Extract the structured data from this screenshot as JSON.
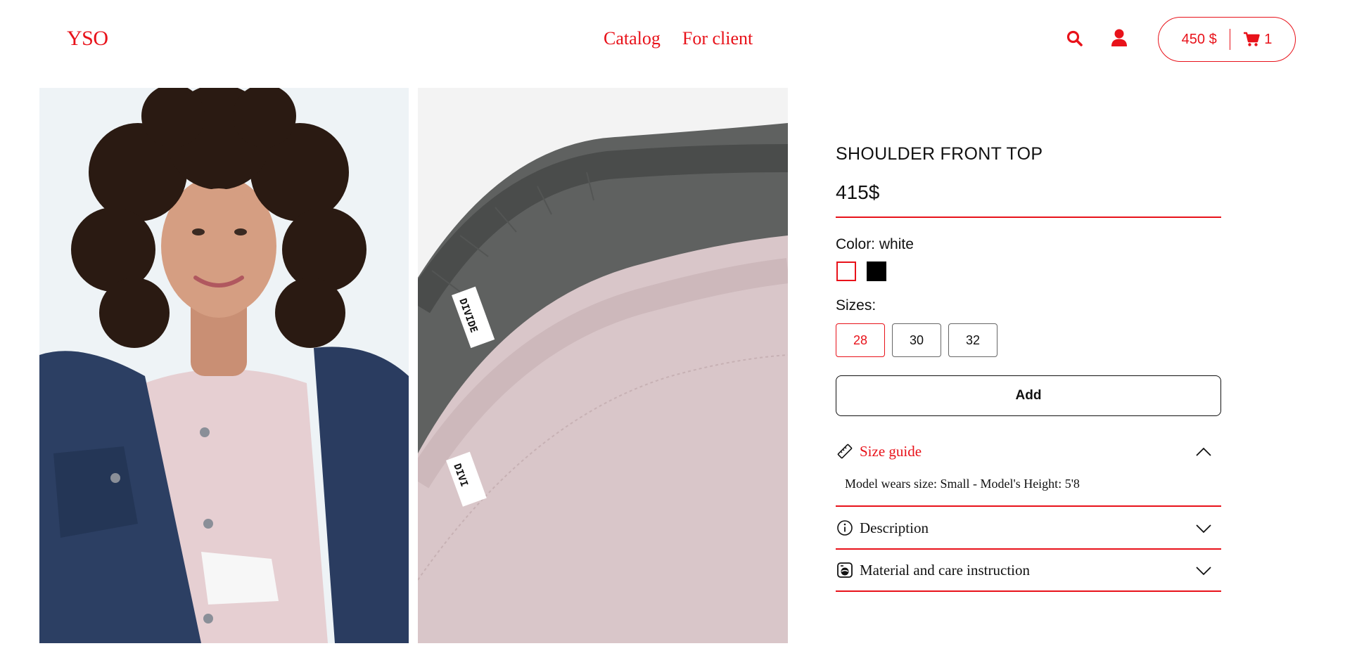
{
  "header": {
    "logo": "YSO",
    "nav": [
      "Catalog",
      "For client"
    ],
    "icons": [
      "search-icon",
      "user-icon",
      "cart-icon"
    ],
    "cart_total": "450 $",
    "cart_count": "1"
  },
  "gallery": {
    "images": [
      "model-wearing-pink-top-and-denim-jacket",
      "folded-gray-and-pink-tops-closeup"
    ]
  },
  "product": {
    "title": "SHOULDER FRONT TOP",
    "price": "415$",
    "color_label": "Color: white",
    "colors": [
      {
        "name": "white",
        "hex": "#ffffff",
        "selected": true
      },
      {
        "name": "black",
        "hex": "#000000",
        "selected": false
      }
    ],
    "sizes_label": "Sizes:",
    "sizes": [
      "28",
      "30",
      "32"
    ],
    "selected_size": "28",
    "add_label": "Add"
  },
  "accordion": {
    "size_guide": {
      "label": "Size guide",
      "icon": "ruler-icon",
      "expanded": true,
      "content": "Model wears size: Small - Model's Height: 5'8"
    },
    "description": {
      "label": "Description",
      "icon": "info-icon",
      "expanded": false
    },
    "material": {
      "label": "Material and care instruction",
      "icon": "washing-machine-icon",
      "expanded": false
    }
  },
  "colors": {
    "accent": "#e8121a",
    "text": "#111111",
    "background": "#ffffff"
  }
}
